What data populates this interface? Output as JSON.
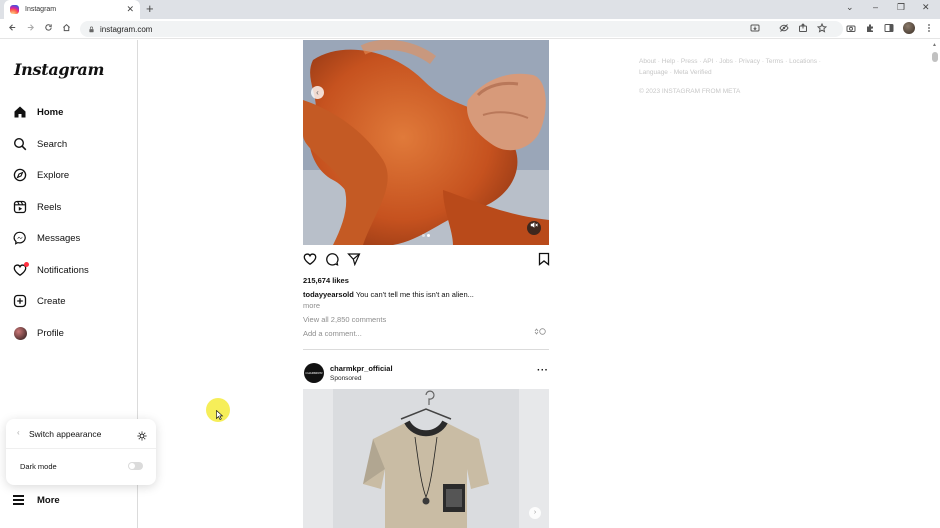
{
  "browser": {
    "tab_title": "Instagram",
    "tab_close": "✕",
    "new_tab": "+",
    "url": "instagram.com",
    "window_controls": [
      "⌄",
      "–",
      "❐",
      "✕"
    ]
  },
  "sidebar": {
    "logo": "Instagram",
    "items": [
      {
        "label": "Home",
        "icon": "home-icon"
      },
      {
        "label": "Search",
        "icon": "search-icon"
      },
      {
        "label": "Explore",
        "icon": "compass-icon"
      },
      {
        "label": "Reels",
        "icon": "reels-icon"
      },
      {
        "label": "Messages",
        "icon": "messenger-icon"
      },
      {
        "label": "Notifications",
        "icon": "heart-icon"
      },
      {
        "label": "Create",
        "icon": "plus-square-icon"
      },
      {
        "label": "Profile",
        "icon": "avatar"
      }
    ],
    "more_label": "More"
  },
  "appearance_popup": {
    "title": "Switch appearance",
    "dark_mode_label": "Dark mode",
    "dark_mode_on": false
  },
  "post": {
    "likes": "215,674 likes",
    "username": "todayyearsold",
    "caption": "You can't tell me this isn't an alien...",
    "more": "more",
    "view_comments": "View all 2,850 comments",
    "comment_placeholder": "Add a comment...",
    "carousel_index": 2,
    "carousel_count": 2
  },
  "ad": {
    "username": "charmkpr_official",
    "sponsored": "Sponsored",
    "avatar_text": "CHARMKPR"
  },
  "footer": {
    "links": "About · Help · Press · API · Jobs · Privacy · Terms · Locations · Language · Meta Verified",
    "copyright": "© 2023 INSTAGRAM FROM META"
  },
  "colors": {
    "notification_dot": "#ff3040",
    "border": "#dbdbdb",
    "muted_text": "#8e8e8e"
  }
}
